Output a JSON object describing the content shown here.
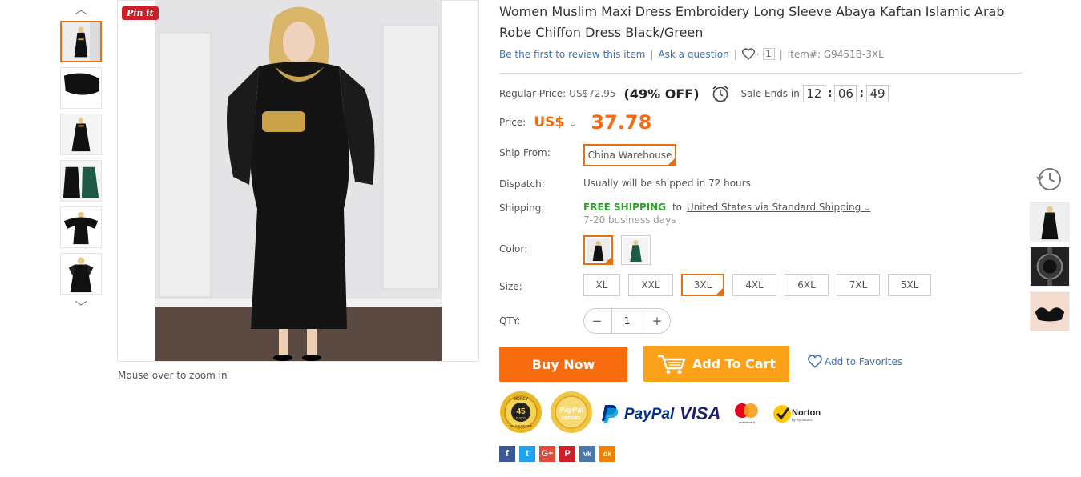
{
  "gallery": {
    "up_arrow": "︿",
    "down_arrow": "﹀",
    "thumbnails": [
      {
        "alt": "front view",
        "active": true
      },
      {
        "alt": "fabric detail",
        "active": false
      },
      {
        "alt": "full length",
        "active": false
      },
      {
        "alt": "black and green",
        "active": false
      },
      {
        "alt": "sleeve view",
        "active": false
      },
      {
        "alt": "back view",
        "active": false
      }
    ],
    "pin_label": "Pin it",
    "zoom_hint": "Mouse over to zoom in"
  },
  "product": {
    "title": "Women Muslim Maxi Dress Embroidery Long Sleeve Abaya Kaftan Islamic Arab Robe Chiffon Dress Black/Green",
    "review_link": "Be the first to review this item",
    "ask_link": "Ask a question",
    "fav_count": "1",
    "item_number": "Item#: G9451B-3XL"
  },
  "pricing": {
    "regular_label": "Regular Price:",
    "regular_price": "US$72.95",
    "discount": "(49% OFF)",
    "sale_label": "Sale Ends in",
    "timer": {
      "hours": "12",
      "minutes": "06",
      "seconds": "49"
    },
    "price_label": "Price:",
    "currency": "US$",
    "price": "37.78"
  },
  "shipping": {
    "ship_from_label": "Ship From:",
    "ship_from_value": "China Warehouse",
    "dispatch_label": "Dispatch:",
    "dispatch_value": "Usually will be shipped in 72 hours",
    "shipping_label": "Shipping:",
    "free_shipping": "FREE SHIPPING",
    "to_text": "to",
    "destination": "United States via Standard Shipping",
    "days": "7-20 business days"
  },
  "options": {
    "color_label": "Color:",
    "colors": [
      {
        "name": "Black",
        "selected": true
      },
      {
        "name": "Green",
        "selected": false
      }
    ],
    "size_label": "Size:",
    "sizes": [
      "XL",
      "XXL",
      "3XL",
      "4XL",
      "6XL",
      "7XL",
      "5XL"
    ],
    "selected_size": "3XL",
    "qty_label": "QTY:",
    "qty_minus": "−",
    "qty_plus": "+",
    "qty_value": "1"
  },
  "actions": {
    "buy_now": "Buy Now",
    "add_to_cart": "Add To Cart",
    "add_to_favorites": "Add to Favorites"
  },
  "badges": {
    "money_back_top": "MONEY",
    "money_back_days": "45",
    "money_back_sub": "DAYS",
    "money_back_bottom": "GUARANTEE",
    "paypal_verified_top": "PayPal",
    "paypal_verified_bottom": "VERIFIED",
    "paypal": "PayPal",
    "visa": "VISA",
    "mastercard": "mastercard",
    "norton": "Norton",
    "norton_sub": "by Symantec"
  },
  "social": [
    "f",
    "t",
    "G+",
    "P",
    "vk",
    "ok"
  ],
  "colors": {
    "accent_orange": "#f56b14",
    "buy_now_bg": "#f86b0f",
    "cart_bg": "#fba21a",
    "link_blue": "#3b73b9",
    "free_green": "#30a02f"
  }
}
